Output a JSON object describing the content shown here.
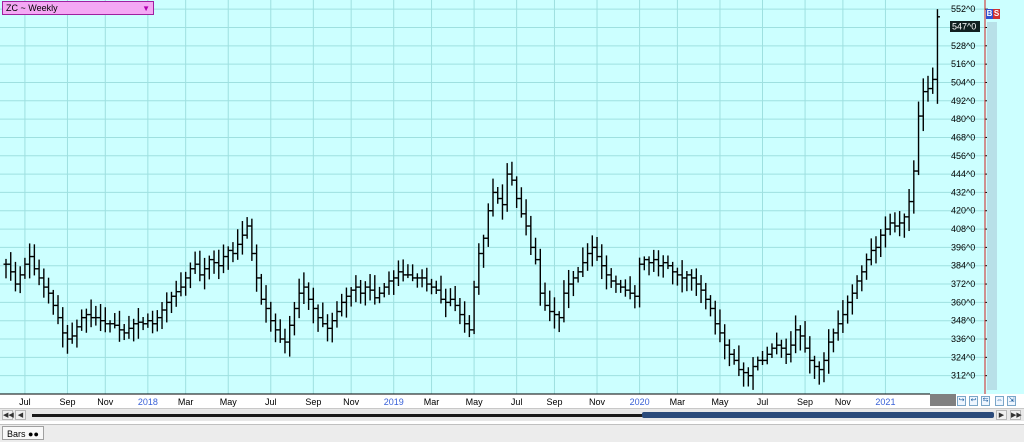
{
  "symbol": {
    "label": "ZC ~ Weekly"
  },
  "buy_sell": {
    "b": "B",
    "s": "S",
    "b_color": "#3050d0",
    "s_color": "#d03030"
  },
  "status": {
    "tab_label": "Bars"
  },
  "colors": {
    "background": "#ccffff",
    "grid": "#9ee0e0",
    "bars": "#000000",
    "right_border": "#d02020",
    "year_label": "#3a62d8",
    "price_badge": "#102020"
  },
  "chart_data": {
    "type": "ohlc",
    "title": "ZC ~ Weekly",
    "ylim": [
      300,
      558
    ],
    "y_ticks": [
      312,
      324,
      336,
      348,
      360,
      372,
      384,
      396,
      408,
      420,
      432,
      444,
      456,
      468,
      480,
      492,
      504,
      516,
      528,
      540,
      552
    ],
    "y_tick_labels": [
      "312^0",
      "324^0",
      "336^0",
      "348^0",
      "360^0",
      "372^0",
      "384^0",
      "396^0",
      "408^0",
      "420^0",
      "432^0",
      "444^0",
      "456^0",
      "468^0",
      "480^0",
      "492^0",
      "504^0",
      "516^0",
      "528^0",
      "540^0",
      "552^0"
    ],
    "x_ticks": [
      {
        "label": "Jul",
        "week": 4,
        "year": false
      },
      {
        "label": "Sep",
        "week": 13,
        "year": false
      },
      {
        "label": "Nov",
        "week": 21,
        "year": false
      },
      {
        "label": "2018",
        "week": 30,
        "year": true
      },
      {
        "label": "Mar",
        "week": 38,
        "year": false
      },
      {
        "label": "May",
        "week": 47,
        "year": false
      },
      {
        "label": "Jul",
        "week": 56,
        "year": false
      },
      {
        "label": "Sep",
        "week": 65,
        "year": false
      },
      {
        "label": "Nov",
        "week": 73,
        "year": false
      },
      {
        "label": "2019",
        "week": 82,
        "year": true
      },
      {
        "label": "Mar",
        "week": 90,
        "year": false
      },
      {
        "label": "May",
        "week": 99,
        "year": false
      },
      {
        "label": "Jul",
        "week": 108,
        "year": false
      },
      {
        "label": "Sep",
        "week": 116,
        "year": false
      },
      {
        "label": "Nov",
        "week": 125,
        "year": false
      },
      {
        "label": "2020",
        "week": 134,
        "year": true
      },
      {
        "label": "Mar",
        "week": 142,
        "year": false
      },
      {
        "label": "May",
        "week": 151,
        "year": false
      },
      {
        "label": "Jul",
        "week": 160,
        "year": false
      },
      {
        "label": "Sep",
        "week": 169,
        "year": false
      },
      {
        "label": "Nov",
        "week": 177,
        "year": false
      },
      {
        "label": "2021",
        "week": 186,
        "year": true
      }
    ],
    "last_price": 547,
    "last_price_label": "547^0",
    "closes": [
      385,
      380,
      372,
      378,
      385,
      390,
      382,
      376,
      370,
      366,
      358,
      350,
      340,
      336,
      338,
      344,
      350,
      352,
      350,
      350,
      348,
      346,
      346,
      345,
      342,
      340,
      343,
      346,
      347,
      346,
      348,
      346,
      350,
      355,
      360,
      364,
      367,
      370,
      376,
      382,
      385,
      378,
      382,
      388,
      386,
      384,
      390,
      394,
      392,
      398,
      404,
      410,
      392,
      376,
      362,
      356,
      348,
      342,
      336,
      334,
      345,
      356,
      366,
      370,
      362,
      356,
      350,
      346,
      343,
      348,
      354,
      360,
      364,
      368,
      370,
      366,
      370,
      368,
      363,
      366,
      370,
      374,
      376,
      380,
      378,
      378,
      376,
      376,
      376,
      372,
      370,
      368,
      362,
      360,
      362,
      358,
      352,
      346,
      342,
      370,
      392,
      402,
      420,
      432,
      428,
      424,
      444,
      440,
      428,
      418,
      410,
      396,
      388,
      366,
      358,
      354,
      352,
      350,
      366,
      372,
      376,
      380,
      386,
      392,
      396,
      390,
      384,
      378,
      374,
      372,
      370,
      368,
      366,
      364,
      385,
      388,
      386,
      388,
      384,
      386,
      384,
      380,
      378,
      376,
      378,
      376,
      372,
      368,
      362,
      356,
      346,
      340,
      332,
      326,
      322,
      316,
      314,
      312,
      318,
      322,
      322,
      326,
      330,
      332,
      330,
      326,
      332,
      342,
      338,
      330,
      322,
      318,
      316,
      322,
      334,
      340,
      346,
      352,
      360,
      366,
      374,
      380,
      388,
      394,
      396,
      404,
      408,
      412,
      410,
      412,
      416,
      426,
      446,
      482,
      498,
      500,
      506,
      547
    ],
    "x_week_range": [
      0,
      195
    ]
  }
}
